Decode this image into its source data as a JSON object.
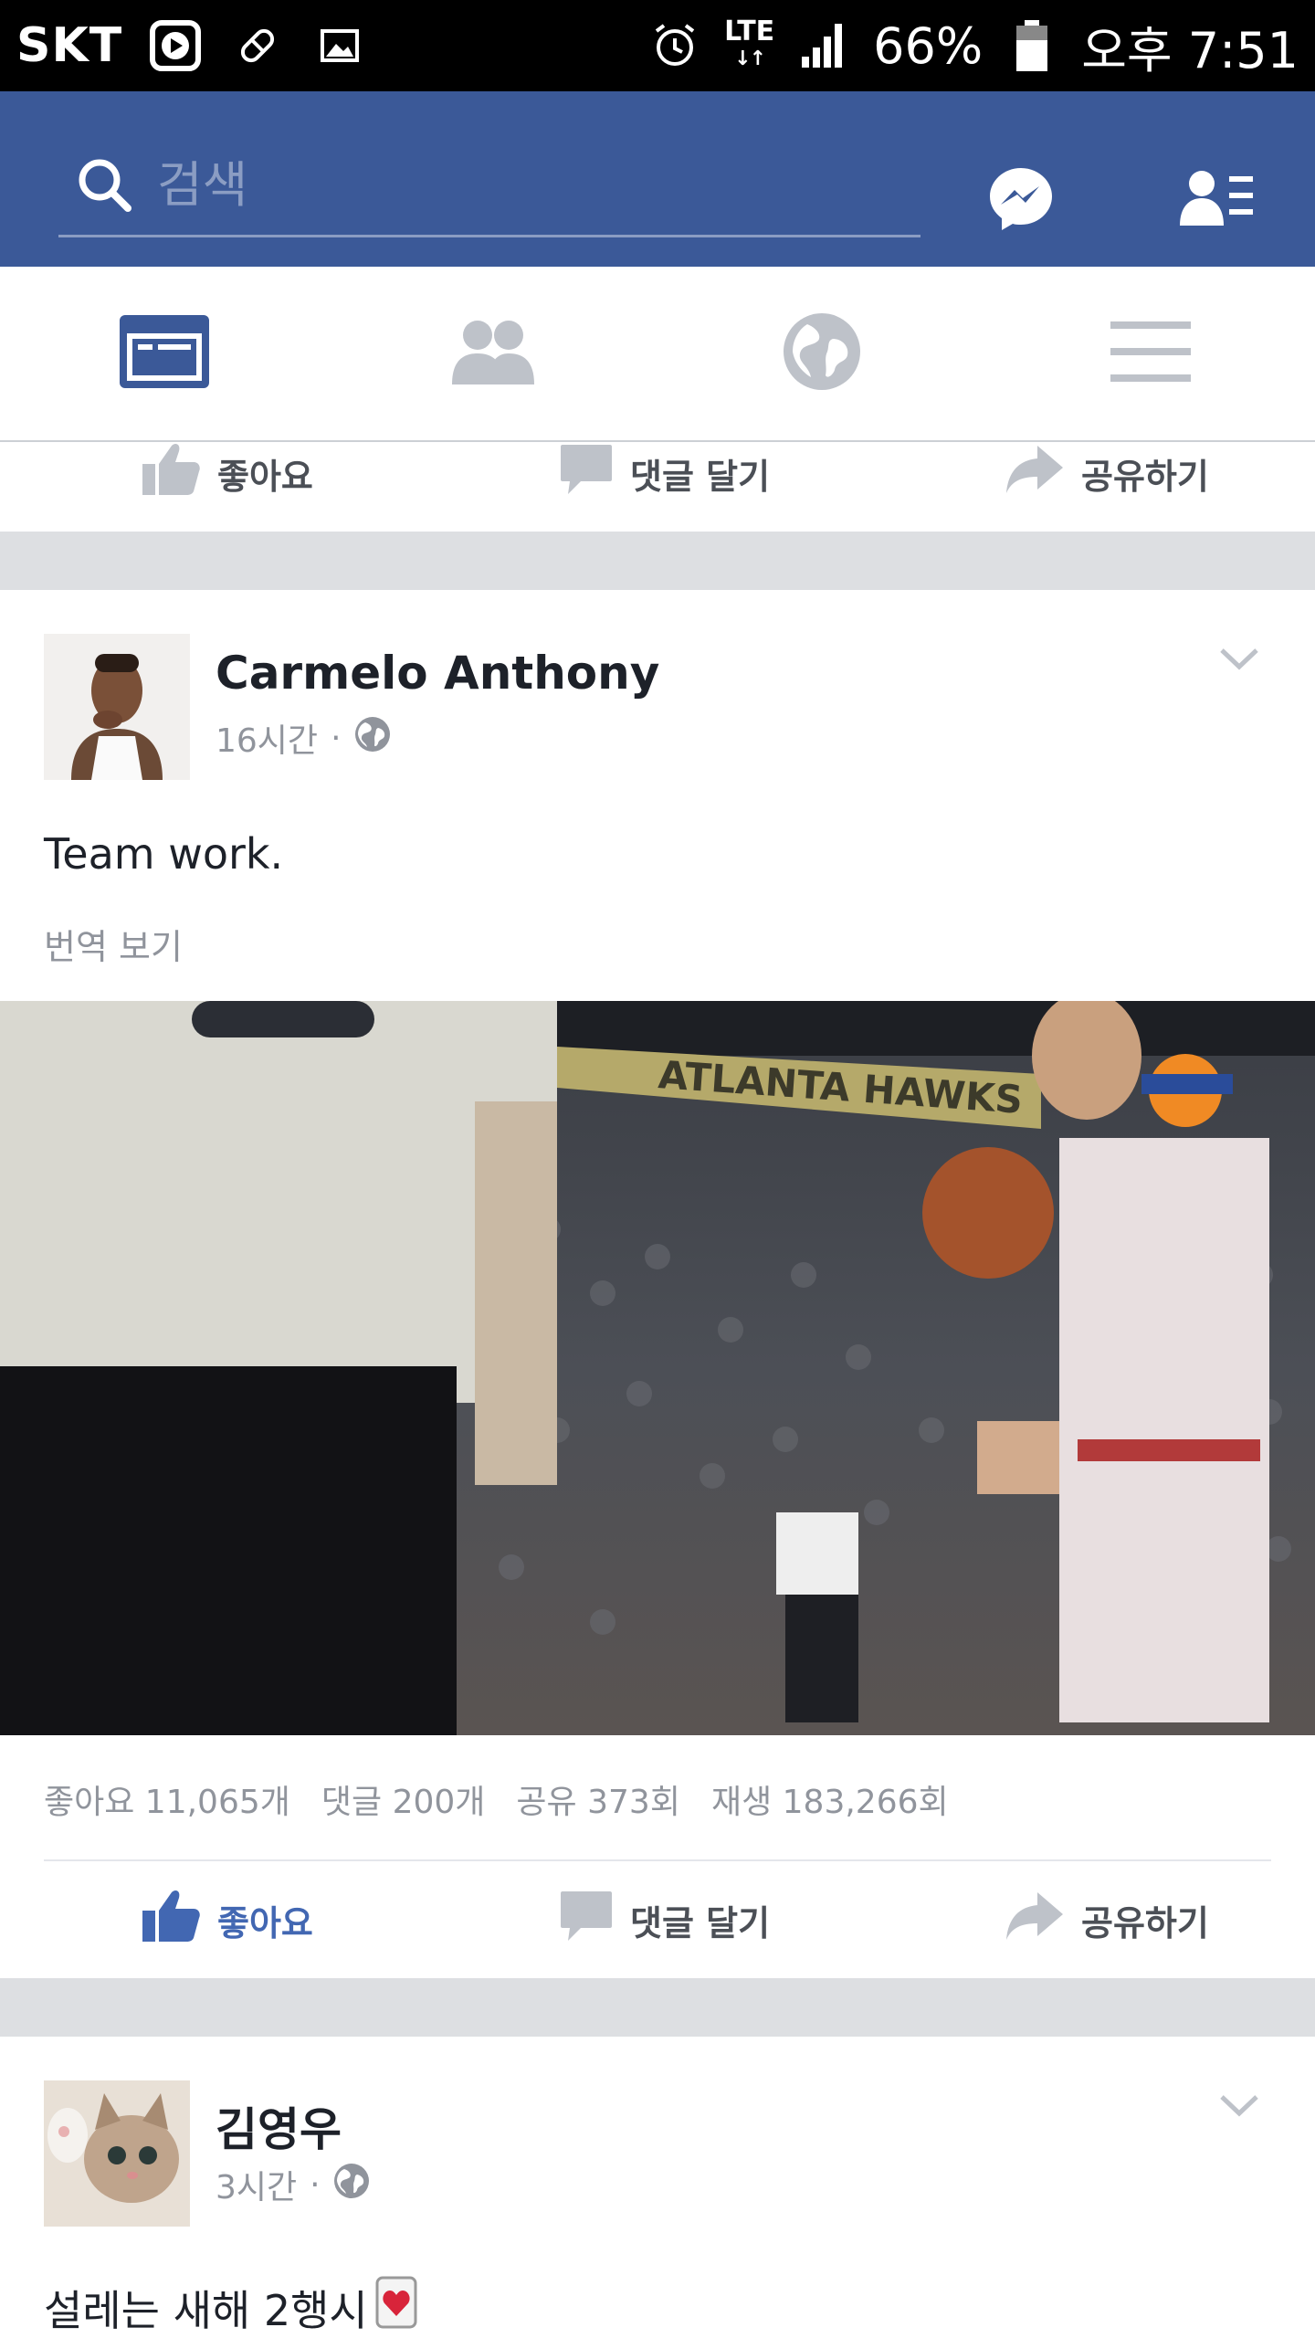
{
  "status_bar": {
    "carrier": "SKT",
    "network": "LTE",
    "battery_percent": "66%",
    "time": "오후 7:51",
    "icons": [
      "play-store-icon",
      "pill-icon",
      "image-icon",
      "alarm-icon",
      "signal-icon",
      "battery-icon"
    ]
  },
  "header": {
    "search_placeholder": "검색",
    "icons": [
      "search-icon",
      "messenger-icon",
      "friend-requests-icon"
    ],
    "color": "#3b5998"
  },
  "tabs": [
    {
      "name": "news-feed",
      "icon": "news-feed-icon",
      "active": true
    },
    {
      "name": "friends",
      "icon": "friends-icon",
      "active": false
    },
    {
      "name": "notifications",
      "icon": "globe-icon",
      "active": false
    },
    {
      "name": "menu",
      "icon": "menu-icon",
      "active": false
    }
  ],
  "top_actions": {
    "like": "좋아요",
    "comment": "댓글 달기",
    "share": "공유하기"
  },
  "posts": [
    {
      "author": "Carmelo Anthony",
      "time": "16시간",
      "text": "Team work.",
      "translate": "번역 보기",
      "stats": {
        "likes": "좋아요 11,065개",
        "comments": "댓글 200개",
        "shares": "공유 373회",
        "views": "재생 183,266회"
      },
      "actions": {
        "like": "좋아요",
        "comment": "댓글 달기",
        "share": "공유하기"
      },
      "liked": true,
      "media_text": "ATLANTA HAWKS"
    },
    {
      "author": "김영우",
      "time": "3시간",
      "text": "설레는 새해 2행시"
    }
  ],
  "colors": {
    "accent": "#3b5998",
    "like_blue": "#4267b2",
    "muted": "#90949c",
    "band": "#dddfe2"
  }
}
